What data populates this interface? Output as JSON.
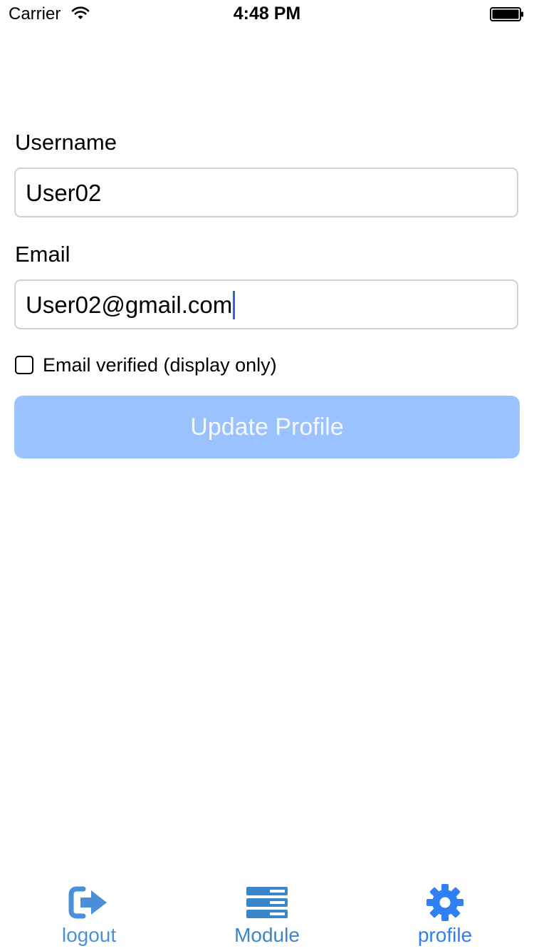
{
  "status_bar": {
    "carrier": "Carrier",
    "time": "4:48 PM"
  },
  "form": {
    "username_label": "Username",
    "username_value": "User02",
    "email_label": "Email",
    "email_value": "User02@gmail.com",
    "email_verified_label": "Email verified (display only)",
    "email_verified_checked": false,
    "update_button_label": "Update Profile"
  },
  "tab_bar": {
    "tabs": [
      {
        "label": "logout",
        "icon": "logout-icon",
        "color": "#4a90d9"
      },
      {
        "label": "Module",
        "icon": "server-icon",
        "color": "#3b86c9"
      },
      {
        "label": "profile",
        "icon": "gear-icon",
        "color": "#2f7ff5"
      }
    ]
  },
  "colors": {
    "button_background": "#99c2fe",
    "caret": "#3a62e0",
    "input_border": "#d0d0d0"
  }
}
